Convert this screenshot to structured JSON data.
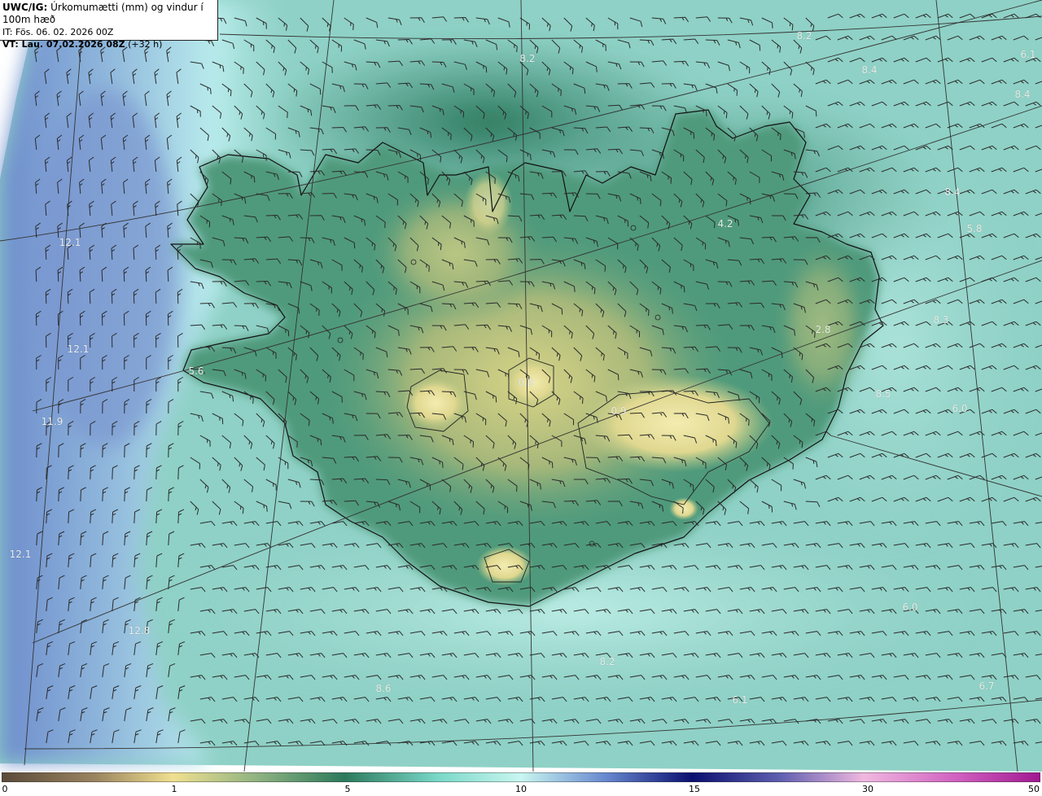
{
  "header": {
    "product_prefix": "UWC/IG:",
    "product_title": " Úrkomumætti (mm) og vindur í 100m hæð",
    "init_line": "IT: Fös. 06. 02. 2026 00Z",
    "valid_prefix": "VT: Lau. 07.02.2026 08Z",
    "valid_suffix": " (+32 h)"
  },
  "colorbar": {
    "ticks": [
      {
        "value": 0,
        "label": "0"
      },
      {
        "value": 1,
        "label": "1"
      },
      {
        "value": 5,
        "label": "5"
      },
      {
        "value": 10,
        "label": "10"
      },
      {
        "value": 15,
        "label": "15"
      },
      {
        "value": 30,
        "label": "30"
      },
      {
        "value": 50,
        "label": "50"
      }
    ],
    "colors": [
      "#5a4a3a",
      "#a08a60",
      "#e8d880",
      "#2f7a5a",
      "#bff3ee",
      "#3040a0",
      "#101070",
      "#d070c0",
      "#b020a0"
    ]
  },
  "value_labels": [
    {
      "text": "8.2"
    },
    {
      "text": "8.2"
    },
    {
      "text": "6.1"
    },
    {
      "text": "8.4"
    },
    {
      "text": "8.4"
    },
    {
      "text": "12.1"
    },
    {
      "text": "4.2"
    },
    {
      "text": "5.8"
    },
    {
      "text": "8.4"
    },
    {
      "text": "12.1"
    },
    {
      "text": "2.8"
    },
    {
      "text": "8.3"
    },
    {
      "text": "5.6"
    },
    {
      "text": "0.9"
    },
    {
      "text": "8.5"
    },
    {
      "text": "11.9"
    },
    {
      "text": "6.0"
    },
    {
      "text": "0.9"
    },
    {
      "text": "12.1"
    },
    {
      "text": "6.0"
    },
    {
      "text": "12.8"
    },
    {
      "text": "8.2"
    },
    {
      "text": "8.6"
    },
    {
      "text": "6.1"
    },
    {
      "text": "6.7"
    }
  ]
}
